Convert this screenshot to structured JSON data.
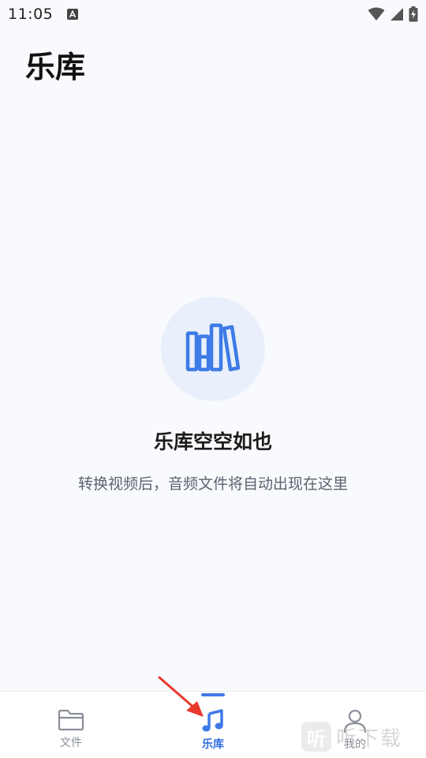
{
  "status_bar": {
    "time": "11:05",
    "icons": [
      "a-notification-icon",
      "wifi-icon",
      "signal-icon",
      "battery-charging-icon"
    ]
  },
  "header": {
    "title": "乐库"
  },
  "empty_state": {
    "icon": "books-icon",
    "title": "乐库空空如也",
    "description": "转换视频后，音频文件将自动出现在这里"
  },
  "bottom_nav": {
    "tabs": [
      {
        "label": "文件",
        "icon": "folder-icon",
        "active": false
      },
      {
        "label": "乐库",
        "icon": "music-note-icon",
        "active": true
      },
      {
        "label": "我的",
        "icon": "user-icon",
        "active": false
      }
    ]
  },
  "watermark": {
    "logo_char": "听",
    "text": "听下载"
  },
  "colors": {
    "accent": "#2f6fe0",
    "background": "#f8fafd",
    "inactive": "#8a8f99",
    "annotation_arrow": "#e8392e"
  }
}
